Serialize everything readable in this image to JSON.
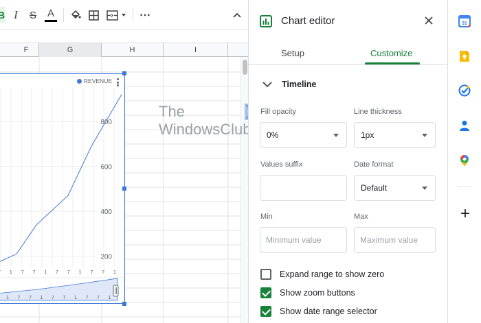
{
  "toolbar": {
    "italic": "I",
    "strikethrough": "S",
    "text_color": "A",
    "more": "⋯",
    "collapse": "^"
  },
  "columns": [
    "F",
    "G",
    "H",
    "I"
  ],
  "chart": {
    "legend": "REVENUE",
    "y_ticks": [
      "800",
      "600",
      "400",
      "200"
    ],
    "x_tick_labels": [
      "7",
      "1",
      "7",
      "7",
      "1",
      "7",
      "7",
      "1",
      "7",
      "7",
      "1"
    ],
    "nav_tick_labels": [
      "1",
      "7",
      "7",
      "1",
      "7",
      "7",
      "1",
      "7",
      "7",
      "1"
    ]
  },
  "chart_data": {
    "type": "line",
    "x": [
      0,
      1,
      2,
      3,
      4,
      5
    ],
    "values": [
      170,
      210,
      340,
      470,
      690,
      920
    ],
    "ylim": [
      150,
      950
    ],
    "legend_position": "top-right",
    "series": [
      {
        "name": "REVENUE",
        "values": [
          170,
          210,
          340,
          470,
          690,
          920
        ]
      }
    ],
    "grid": true
  },
  "watermark": {
    "line1": "The",
    "line2": "WindowsClub"
  },
  "editor": {
    "title": "Chart editor",
    "tabs": [
      {
        "label": "Setup",
        "active": false
      },
      {
        "label": "Customize",
        "active": true
      }
    ],
    "section": "Timeline",
    "fill_opacity": {
      "label": "Fill opacity",
      "value": "0%"
    },
    "line_thickness": {
      "label": "Line thickness",
      "value": "1px"
    },
    "values_suffix": {
      "label": "Values suffix",
      "value": ""
    },
    "date_format": {
      "label": "Date format",
      "value": "Default"
    },
    "min": {
      "label": "Min",
      "placeholder": "Minimum value"
    },
    "max": {
      "label": "Max",
      "placeholder": "Maximum value"
    },
    "checks": [
      {
        "label": "Expand range to show zero",
        "checked": false
      },
      {
        "label": "Show zoom buttons",
        "checked": true
      },
      {
        "label": "Show date range selector",
        "checked": true
      }
    ]
  },
  "colors": {
    "accent_green": "#188038",
    "chart_blue": "#3c78d8",
    "calendar": "#4285f4",
    "keep": "#fbbc04",
    "tasks": "#1a73e8",
    "contacts": "#1a73e8",
    "maps": "#34a853"
  },
  "sidebar": {
    "calendar_day": "31",
    "add": "+"
  }
}
